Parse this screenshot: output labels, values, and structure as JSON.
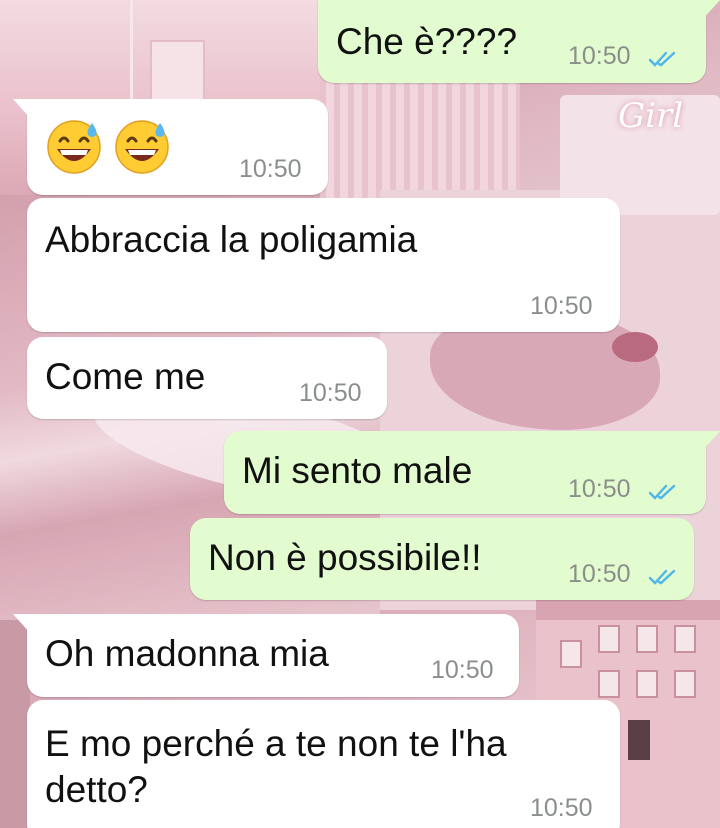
{
  "chat": {
    "messages": [
      {
        "direction": "outgoing",
        "text": "Che è????",
        "time": "10:50",
        "status": "read"
      },
      {
        "direction": "incoming",
        "emoji": [
          "grinning-face-with-sweat",
          "grinning-face-with-sweat"
        ],
        "time": "10:50"
      },
      {
        "direction": "incoming",
        "text": "Abbraccia la poligamia",
        "time": "10:50"
      },
      {
        "direction": "incoming",
        "text": "Come me",
        "time": "10:50"
      },
      {
        "direction": "outgoing",
        "text": "Mi sento male",
        "time": "10:50",
        "status": "read"
      },
      {
        "direction": "outgoing",
        "text": "Non è possibile!!",
        "time": "10:50",
        "status": "read"
      },
      {
        "direction": "incoming",
        "text": "Oh madonna mia",
        "time": "10:50"
      },
      {
        "direction": "incoming",
        "text_lines": [
          "E mo perché a te non te l'ha",
          "detto?"
        ],
        "time": "10:50"
      }
    ]
  },
  "wallpaper": {
    "overlay_text": "Girl"
  },
  "colors": {
    "incoming_bubble": "#ffffff",
    "outgoing_bubble": "#e2fbcf",
    "read_ticks": "#4fb6ec",
    "timestamp": "#8a8f8b"
  }
}
